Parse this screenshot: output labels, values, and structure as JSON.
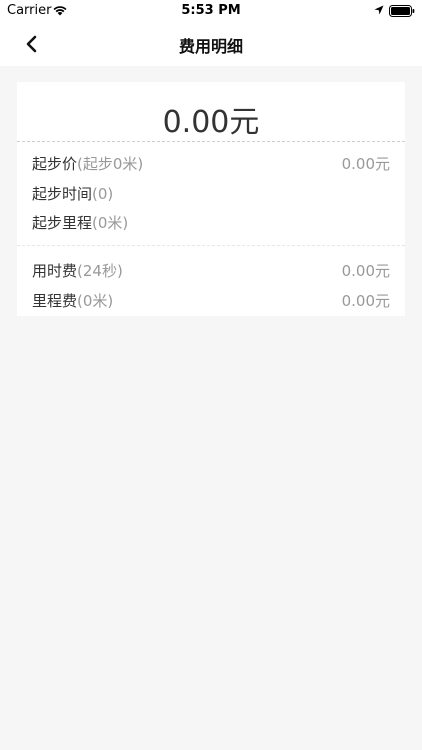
{
  "status_bar": {
    "carrier": "Carrier",
    "time": "5:53 PM"
  },
  "nav": {
    "title": "费用明细"
  },
  "fee": {
    "total": "0.00元",
    "base_items": [
      {
        "label": "起步价",
        "sub": "(起步0米)",
        "value": "0.00元"
      },
      {
        "label": "起步时间",
        "sub": "(0)",
        "value": ""
      },
      {
        "label": "起步里程",
        "sub": "(0米)",
        "value": ""
      }
    ],
    "charge_items": [
      {
        "label": "用时费",
        "sub": "(24秒)",
        "value": "0.00元"
      },
      {
        "label": "里程费",
        "sub": "(0米)",
        "value": "0.00元"
      }
    ]
  }
}
